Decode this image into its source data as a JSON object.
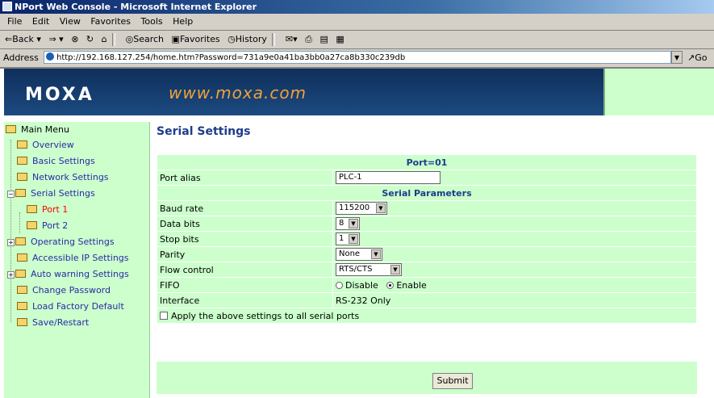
{
  "window": {
    "title": "NPort Web Console - Microsoft Internet Explorer"
  },
  "menubar": [
    "File",
    "Edit",
    "View",
    "Favorites",
    "Tools",
    "Help"
  ],
  "toolbar": {
    "back": "⇐Back ▾",
    "forward": "⇒ ▾",
    "search": "Search",
    "favorites": "Favorites",
    "history": "History"
  },
  "address": {
    "label": "Address",
    "url": "http://192.168.127.254/home.htm?Password=731a9e0a41ba3bb0a27ca8b330c239db",
    "go": "Go"
  },
  "banner": {
    "logo": "MOXA",
    "site": "www.moxa.com"
  },
  "menu": {
    "root": "Main Menu",
    "items": {
      "overview": "Overview",
      "basic": "Basic Settings",
      "network": "Network Settings",
      "serial": "Serial Settings",
      "port1": "Port 1",
      "port2": "Port 2",
      "operating": "Operating Settings",
      "accessible_ip": "Accessible IP Settings",
      "auto_warning": "Auto warning Settings",
      "change_password": "Change Password",
      "load_factory": "Load Factory Default",
      "save_restart": "Save/Restart"
    }
  },
  "page": {
    "title": "Serial Settings",
    "port_header": "Port=01",
    "port_alias_label": "Port alias",
    "port_alias_value": "PLC-1",
    "serial_params_header": "Serial Parameters",
    "baud_rate_label": "Baud rate",
    "baud_rate_value": "115200",
    "data_bits_label": "Data bits",
    "data_bits_value": "8",
    "stop_bits_label": "Stop bits",
    "stop_bits_value": "1",
    "parity_label": "Parity",
    "parity_value": "None",
    "flow_control_label": "Flow control",
    "flow_control_value": "RTS/CTS",
    "fifo_label": "FIFO",
    "fifo_disable": "Disable",
    "fifo_enable": "Enable",
    "fifo_selected": "Enable",
    "interface_label": "Interface",
    "interface_value": "RS-232 Only",
    "apply_all_label": "Apply the above settings to all serial ports",
    "submit_label": "Submit"
  }
}
